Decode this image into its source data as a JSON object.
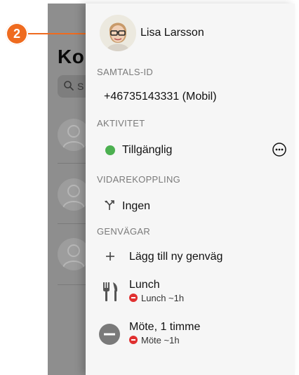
{
  "background_app": {
    "title_fragment": "Ko",
    "search_fragment": "S"
  },
  "marker": {
    "number": "2"
  },
  "panel": {
    "user_name": "Lisa Larsson",
    "sections": {
      "caller_id_header": "SAMTALS-ID",
      "caller_id_value": "+46735143331 (Mobil)",
      "activity_header": "AKTIVITET",
      "activity_value": "Tillgänglig",
      "forwarding_header": "VIDAREKOPPLING",
      "forwarding_value": "Ingen",
      "shortcuts_header": "GENVÄGAR"
    },
    "shortcuts": {
      "add_label": "Lägg till ny genväg",
      "items": [
        {
          "title": "Lunch",
          "subtitle": "Lunch ~1h",
          "icon": "fork-knife-icon"
        },
        {
          "title": "Möte, 1 timme",
          "subtitle": "Möte ~1h",
          "icon": "minus-circle-icon"
        }
      ]
    }
  },
  "colors": {
    "marker": "#ef6b1f",
    "available": "#4cb050",
    "busy": "#e03030"
  }
}
